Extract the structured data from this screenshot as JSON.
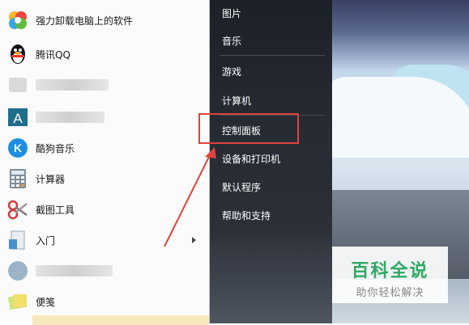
{
  "left_menu": {
    "items": [
      {
        "label": "强力卸载电脑上的软件",
        "icon": "colorful-uninstall-icon"
      },
      {
        "label": "腾讯QQ",
        "icon": "qq-penguin-icon"
      },
      {
        "label": "",
        "icon": "blurred-app-icon"
      },
      {
        "label": "",
        "icon": "a-app-icon"
      },
      {
        "label": "酷狗音乐",
        "icon": "kugou-icon"
      },
      {
        "label": "计算器",
        "icon": "calculator-icon"
      },
      {
        "label": "截图工具",
        "icon": "scissors-icon"
      },
      {
        "label": "入门",
        "icon": "getting-started-icon"
      },
      {
        "label": "",
        "icon": "blurred-app-icon"
      },
      {
        "label": "便笺",
        "icon": "sticky-notes-icon"
      }
    ]
  },
  "right_menu": {
    "items": [
      "图片",
      "音乐",
      "游戏",
      "计算机",
      "控制面板",
      "设备和打印机",
      "默认程序",
      "帮助和支持"
    ],
    "highlighted": "控制面板"
  },
  "annotation": {
    "color": "#e0433b"
  },
  "watermark": {
    "title": "百科全说",
    "subtitle": "助你轻松解决"
  }
}
